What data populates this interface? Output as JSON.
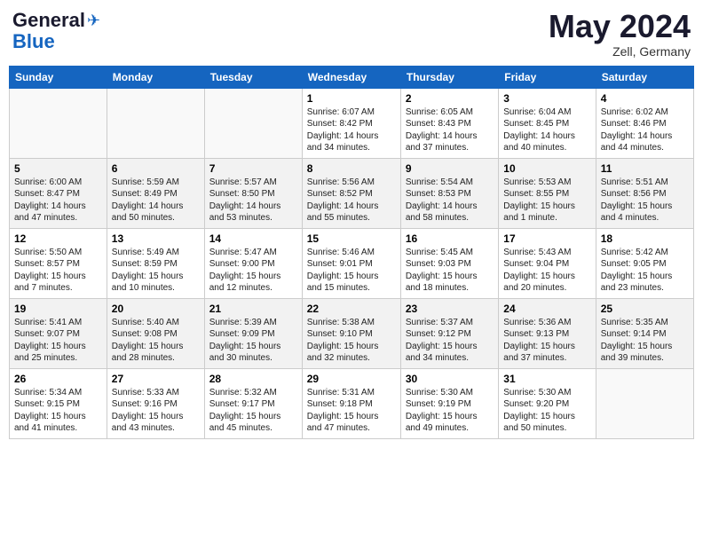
{
  "header": {
    "logo_general": "General",
    "logo_blue": "Blue",
    "month_year": "May 2024",
    "location": "Zell, Germany"
  },
  "weekdays": [
    "Sunday",
    "Monday",
    "Tuesday",
    "Wednesday",
    "Thursday",
    "Friday",
    "Saturday"
  ],
  "weeks": [
    [
      {
        "day": "",
        "info": ""
      },
      {
        "day": "",
        "info": ""
      },
      {
        "day": "",
        "info": ""
      },
      {
        "day": "1",
        "info": "Sunrise: 6:07 AM\nSunset: 8:42 PM\nDaylight: 14 hours\nand 34 minutes."
      },
      {
        "day": "2",
        "info": "Sunrise: 6:05 AM\nSunset: 8:43 PM\nDaylight: 14 hours\nand 37 minutes."
      },
      {
        "day": "3",
        "info": "Sunrise: 6:04 AM\nSunset: 8:45 PM\nDaylight: 14 hours\nand 40 minutes."
      },
      {
        "day": "4",
        "info": "Sunrise: 6:02 AM\nSunset: 8:46 PM\nDaylight: 14 hours\nand 44 minutes."
      }
    ],
    [
      {
        "day": "5",
        "info": "Sunrise: 6:00 AM\nSunset: 8:47 PM\nDaylight: 14 hours\nand 47 minutes."
      },
      {
        "day": "6",
        "info": "Sunrise: 5:59 AM\nSunset: 8:49 PM\nDaylight: 14 hours\nand 50 minutes."
      },
      {
        "day": "7",
        "info": "Sunrise: 5:57 AM\nSunset: 8:50 PM\nDaylight: 14 hours\nand 53 minutes."
      },
      {
        "day": "8",
        "info": "Sunrise: 5:56 AM\nSunset: 8:52 PM\nDaylight: 14 hours\nand 55 minutes."
      },
      {
        "day": "9",
        "info": "Sunrise: 5:54 AM\nSunset: 8:53 PM\nDaylight: 14 hours\nand 58 minutes."
      },
      {
        "day": "10",
        "info": "Sunrise: 5:53 AM\nSunset: 8:55 PM\nDaylight: 15 hours\nand 1 minute."
      },
      {
        "day": "11",
        "info": "Sunrise: 5:51 AM\nSunset: 8:56 PM\nDaylight: 15 hours\nand 4 minutes."
      }
    ],
    [
      {
        "day": "12",
        "info": "Sunrise: 5:50 AM\nSunset: 8:57 PM\nDaylight: 15 hours\nand 7 minutes."
      },
      {
        "day": "13",
        "info": "Sunrise: 5:49 AM\nSunset: 8:59 PM\nDaylight: 15 hours\nand 10 minutes."
      },
      {
        "day": "14",
        "info": "Sunrise: 5:47 AM\nSunset: 9:00 PM\nDaylight: 15 hours\nand 12 minutes."
      },
      {
        "day": "15",
        "info": "Sunrise: 5:46 AM\nSunset: 9:01 PM\nDaylight: 15 hours\nand 15 minutes."
      },
      {
        "day": "16",
        "info": "Sunrise: 5:45 AM\nSunset: 9:03 PM\nDaylight: 15 hours\nand 18 minutes."
      },
      {
        "day": "17",
        "info": "Sunrise: 5:43 AM\nSunset: 9:04 PM\nDaylight: 15 hours\nand 20 minutes."
      },
      {
        "day": "18",
        "info": "Sunrise: 5:42 AM\nSunset: 9:05 PM\nDaylight: 15 hours\nand 23 minutes."
      }
    ],
    [
      {
        "day": "19",
        "info": "Sunrise: 5:41 AM\nSunset: 9:07 PM\nDaylight: 15 hours\nand 25 minutes."
      },
      {
        "day": "20",
        "info": "Sunrise: 5:40 AM\nSunset: 9:08 PM\nDaylight: 15 hours\nand 28 minutes."
      },
      {
        "day": "21",
        "info": "Sunrise: 5:39 AM\nSunset: 9:09 PM\nDaylight: 15 hours\nand 30 minutes."
      },
      {
        "day": "22",
        "info": "Sunrise: 5:38 AM\nSunset: 9:10 PM\nDaylight: 15 hours\nand 32 minutes."
      },
      {
        "day": "23",
        "info": "Sunrise: 5:37 AM\nSunset: 9:12 PM\nDaylight: 15 hours\nand 34 minutes."
      },
      {
        "day": "24",
        "info": "Sunrise: 5:36 AM\nSunset: 9:13 PM\nDaylight: 15 hours\nand 37 minutes."
      },
      {
        "day": "25",
        "info": "Sunrise: 5:35 AM\nSunset: 9:14 PM\nDaylight: 15 hours\nand 39 minutes."
      }
    ],
    [
      {
        "day": "26",
        "info": "Sunrise: 5:34 AM\nSunset: 9:15 PM\nDaylight: 15 hours\nand 41 minutes."
      },
      {
        "day": "27",
        "info": "Sunrise: 5:33 AM\nSunset: 9:16 PM\nDaylight: 15 hours\nand 43 minutes."
      },
      {
        "day": "28",
        "info": "Sunrise: 5:32 AM\nSunset: 9:17 PM\nDaylight: 15 hours\nand 45 minutes."
      },
      {
        "day": "29",
        "info": "Sunrise: 5:31 AM\nSunset: 9:18 PM\nDaylight: 15 hours\nand 47 minutes."
      },
      {
        "day": "30",
        "info": "Sunrise: 5:30 AM\nSunset: 9:19 PM\nDaylight: 15 hours\nand 49 minutes."
      },
      {
        "day": "31",
        "info": "Sunrise: 5:30 AM\nSunset: 9:20 PM\nDaylight: 15 hours\nand 50 minutes."
      },
      {
        "day": "",
        "info": ""
      }
    ]
  ]
}
